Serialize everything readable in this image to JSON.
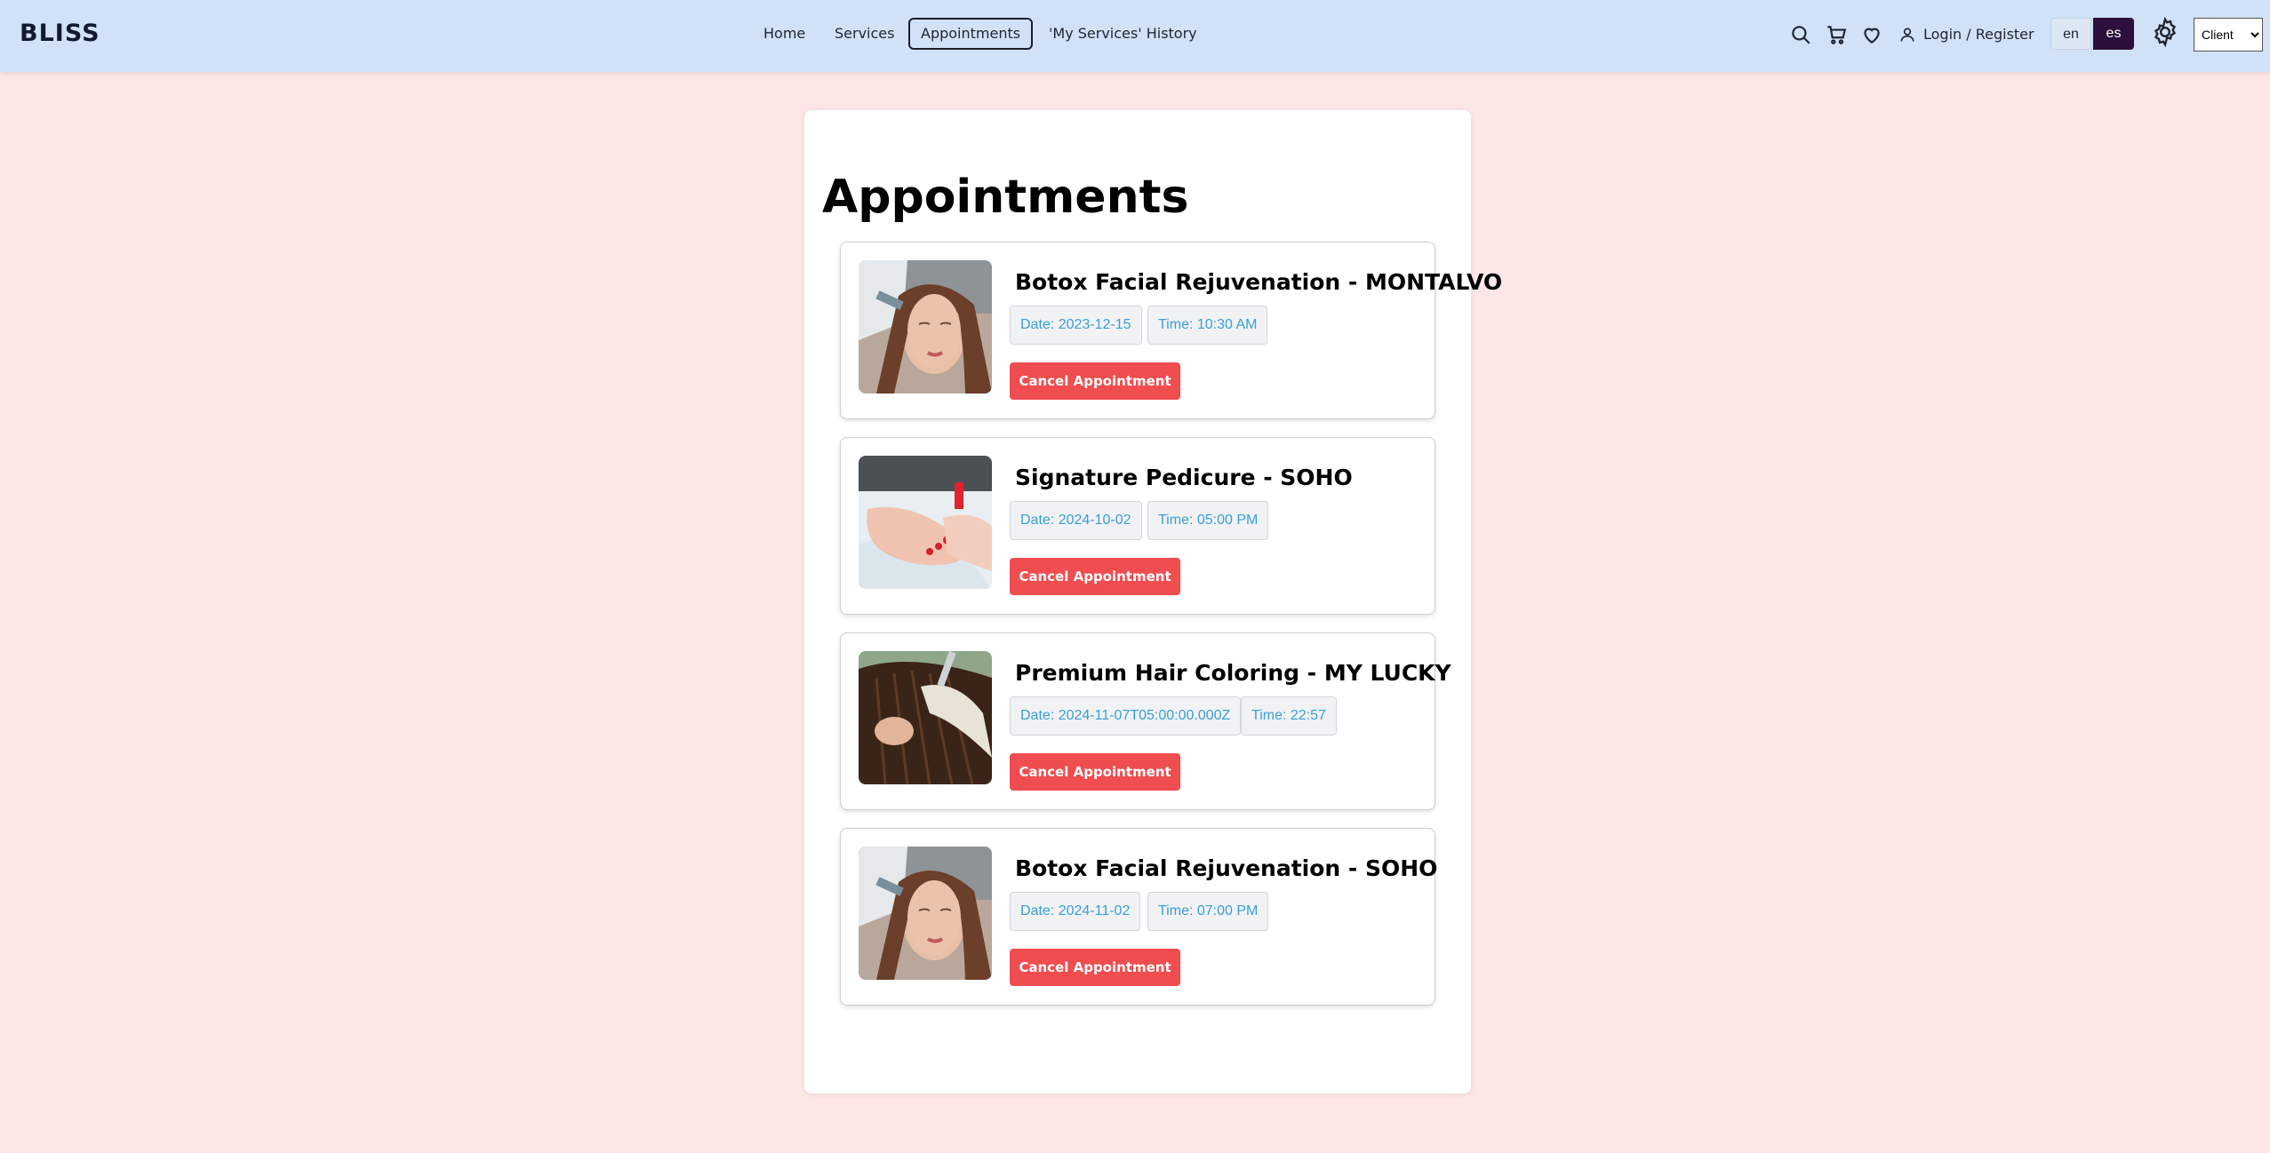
{
  "header": {
    "brand": "BLISS",
    "nav": [
      {
        "label": "Home"
      },
      {
        "label": "Services"
      },
      {
        "label": "Appointments"
      },
      {
        "label": "'My Services' History"
      }
    ],
    "login_label": "Login / Register",
    "lang_en": "en",
    "lang_es": "es",
    "role_selected": "Client",
    "icons": [
      "search-icon",
      "cart-icon",
      "heart-icon",
      "user-icon",
      "gear-icon"
    ]
  },
  "main": {
    "title": "Appointments",
    "appointments": [
      {
        "title": "Botox Facial Rejuvenation - MONTALVO",
        "date": "Date: 2023-12-15",
        "time": "Time: 10:30 AM",
        "cancel_label": "Cancel Appointment",
        "image": "facial-treatment"
      },
      {
        "title": "Signature Pedicure - SOHO",
        "date": "Date: 2024-10-02",
        "time": "Time: 05:00 PM",
        "cancel_label": "Cancel Appointment",
        "image": "pedicure"
      },
      {
        "title": "Premium Hair Coloring - MY LUCKY",
        "date": "Date: 2024-11-07T05:00:00.000Z",
        "time": "Time: 22:57",
        "cancel_label": "Cancel Appointment",
        "image": "hair-coloring"
      },
      {
        "title": "Botox Facial Rejuvenation - SOHO",
        "date": "Date: 2024-11-02",
        "time": "Time: 07:00 PM",
        "cancel_label": "Cancel Appointment",
        "image": "facial-treatment"
      }
    ]
  },
  "colors": {
    "header_bg": "#d1e2f6",
    "page_bg": "#fde6e6",
    "cancel_button": "#ef4d4f",
    "pill_text": "#3a9fd8",
    "lang_active": "#2c0f3a"
  }
}
